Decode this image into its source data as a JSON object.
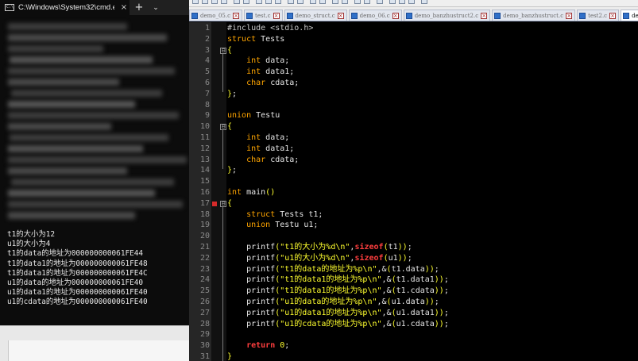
{
  "cmd": {
    "title": "C:\\Windows\\System32\\cmd.ex",
    "tab_icon_text": "C:\\",
    "close": "×",
    "new_tab": "+",
    "dropdown": "⌄",
    "output": [
      "t1的大小为12",
      "u1的大小为4",
      "t1的data的地址为000000000061FE44",
      "t1的data1的地址为000000000061FE48",
      "t1的data1的地址为000000000061FE4C",
      "u1的data的地址为000000000061FE40",
      "u1的data1的地址为000000000061FE40",
      "u1的cdata的地址为000000000061FE40"
    ]
  },
  "editor": {
    "tabs": [
      {
        "label": "demo_05.c",
        "active": false
      },
      {
        "label": "test.c",
        "active": false
      },
      {
        "label": "demo_struct.c",
        "active": false
      },
      {
        "label": "demo_06.c",
        "active": false
      },
      {
        "label": "demo_banzhustruct2.c",
        "active": false
      },
      {
        "label": "demo_banzhustruct.c",
        "active": false
      },
      {
        "label": "test2.c",
        "active": false
      },
      {
        "label": "de",
        "active": true
      }
    ],
    "tab_close": "×",
    "lines": [
      {
        "n": "1",
        "segs": [
          [
            "pre",
            "#include <stdio.h>"
          ]
        ]
      },
      {
        "n": "2",
        "segs": [
          [
            "kw",
            "struct"
          ],
          [
            "plain",
            " Tests"
          ]
        ]
      },
      {
        "n": "3",
        "fold": "⊟",
        "segs": [
          [
            "op",
            "{"
          ]
        ]
      },
      {
        "n": "4",
        "segs": [
          [
            "plain",
            "    "
          ],
          [
            "kw",
            "int"
          ],
          [
            "plain",
            " data;"
          ]
        ]
      },
      {
        "n": "5",
        "segs": [
          [
            "plain",
            "    "
          ],
          [
            "kw",
            "int"
          ],
          [
            "plain",
            " data1;"
          ]
        ]
      },
      {
        "n": "6",
        "segs": [
          [
            "plain",
            "    "
          ],
          [
            "kw",
            "char"
          ],
          [
            "plain",
            " cdata;"
          ]
        ]
      },
      {
        "n": "7",
        "segs": [
          [
            "op",
            "}"
          ],
          [
            "plain",
            ";"
          ]
        ]
      },
      {
        "n": "8",
        "segs": []
      },
      {
        "n": "9",
        "segs": [
          [
            "kw",
            "union"
          ],
          [
            "plain",
            " Testu"
          ]
        ]
      },
      {
        "n": "10",
        "fold": "⊟",
        "segs": [
          [
            "op",
            "{"
          ]
        ]
      },
      {
        "n": "11",
        "segs": [
          [
            "plain",
            "    "
          ],
          [
            "kw",
            "int"
          ],
          [
            "plain",
            " data;"
          ]
        ]
      },
      {
        "n": "12",
        "segs": [
          [
            "plain",
            "    "
          ],
          [
            "kw",
            "int"
          ],
          [
            "plain",
            " data1;"
          ]
        ]
      },
      {
        "n": "13",
        "segs": [
          [
            "plain",
            "    "
          ],
          [
            "kw",
            "char"
          ],
          [
            "plain",
            " cdata;"
          ]
        ]
      },
      {
        "n": "14",
        "segs": [
          [
            "op",
            "}"
          ],
          [
            "plain",
            ";"
          ]
        ]
      },
      {
        "n": "15",
        "segs": []
      },
      {
        "n": "16",
        "segs": [
          [
            "kw",
            "int"
          ],
          [
            "plain",
            " main"
          ],
          [
            "op",
            "()"
          ]
        ]
      },
      {
        "n": "17",
        "fold": "⊟",
        "bookmark": true,
        "segs": [
          [
            "op",
            "{"
          ]
        ]
      },
      {
        "n": "18",
        "segs": [
          [
            "plain",
            "    "
          ],
          [
            "kw",
            "struct"
          ],
          [
            "plain",
            " Tests t1;"
          ]
        ]
      },
      {
        "n": "19",
        "segs": [
          [
            "plain",
            "    "
          ],
          [
            "kw",
            "union"
          ],
          [
            "plain",
            " Testu u1;"
          ]
        ]
      },
      {
        "n": "20",
        "segs": []
      },
      {
        "n": "21",
        "segs": [
          [
            "plain",
            "    printf"
          ],
          [
            "op",
            "("
          ],
          [
            "str",
            "\"t1的大小为%d\\n\""
          ],
          [
            "plain",
            ","
          ],
          [
            "kw2",
            "sizeof"
          ],
          [
            "op",
            "("
          ],
          [
            "plain",
            "t1"
          ],
          [
            "op",
            "))"
          ],
          [
            "plain",
            ";"
          ]
        ]
      },
      {
        "n": "22",
        "segs": [
          [
            "plain",
            "    printf"
          ],
          [
            "op",
            "("
          ],
          [
            "str",
            "\"u1的大小为%d\\n\""
          ],
          [
            "plain",
            ","
          ],
          [
            "kw2",
            "sizeof"
          ],
          [
            "op",
            "("
          ],
          [
            "plain",
            "u1"
          ],
          [
            "op",
            "))"
          ],
          [
            "plain",
            ";"
          ]
        ]
      },
      {
        "n": "23",
        "segs": [
          [
            "plain",
            "    printf"
          ],
          [
            "op",
            "("
          ],
          [
            "str",
            "\"t1的data的地址为%p\\n\""
          ],
          [
            "plain",
            ",&"
          ],
          [
            "op",
            "("
          ],
          [
            "plain",
            "t1.data"
          ],
          [
            "op",
            "))"
          ],
          [
            "plain",
            ";"
          ]
        ]
      },
      {
        "n": "24",
        "segs": [
          [
            "plain",
            "    printf"
          ],
          [
            "op",
            "("
          ],
          [
            "str",
            "\"t1的data1的地址为%p\\n\""
          ],
          [
            "plain",
            ",&"
          ],
          [
            "op",
            "("
          ],
          [
            "plain",
            "t1.data1"
          ],
          [
            "op",
            "))"
          ],
          [
            "plain",
            ";"
          ]
        ]
      },
      {
        "n": "25",
        "segs": [
          [
            "plain",
            "    printf"
          ],
          [
            "op",
            "("
          ],
          [
            "str",
            "\"t1的data1的地址为%p\\n\""
          ],
          [
            "plain",
            ",&"
          ],
          [
            "op",
            "("
          ],
          [
            "plain",
            "t1.cdata"
          ],
          [
            "op",
            "))"
          ],
          [
            "plain",
            ";"
          ]
        ]
      },
      {
        "n": "26",
        "segs": [
          [
            "plain",
            "    printf"
          ],
          [
            "op",
            "("
          ],
          [
            "str",
            "\"u1的data的地址为%p\\n\""
          ],
          [
            "plain",
            ",&"
          ],
          [
            "op",
            "("
          ],
          [
            "plain",
            "u1.data"
          ],
          [
            "op",
            "))"
          ],
          [
            "plain",
            ";"
          ]
        ]
      },
      {
        "n": "27",
        "segs": [
          [
            "plain",
            "    printf"
          ],
          [
            "op",
            "("
          ],
          [
            "str",
            "\"u1的data1的地址为%p\\n\""
          ],
          [
            "plain",
            ",&"
          ],
          [
            "op",
            "("
          ],
          [
            "plain",
            "u1.data1"
          ],
          [
            "op",
            "))"
          ],
          [
            "plain",
            ";"
          ]
        ]
      },
      {
        "n": "28",
        "segs": [
          [
            "plain",
            "    printf"
          ],
          [
            "op",
            "("
          ],
          [
            "str",
            "\"u1的cdata的地址为%p\\n\""
          ],
          [
            "plain",
            ",&"
          ],
          [
            "op",
            "("
          ],
          [
            "plain",
            "u1.cdata"
          ],
          [
            "op",
            "))"
          ],
          [
            "plain",
            ";"
          ]
        ]
      },
      {
        "n": "29",
        "segs": []
      },
      {
        "n": "30",
        "segs": [
          [
            "plain",
            "    "
          ],
          [
            "kw2",
            "return"
          ],
          [
            "plain",
            " "
          ],
          [
            "op",
            "0"
          ],
          [
            "plain",
            ";"
          ]
        ]
      },
      {
        "n": "31",
        "segs": [
          [
            "op",
            "}"
          ]
        ]
      }
    ]
  }
}
